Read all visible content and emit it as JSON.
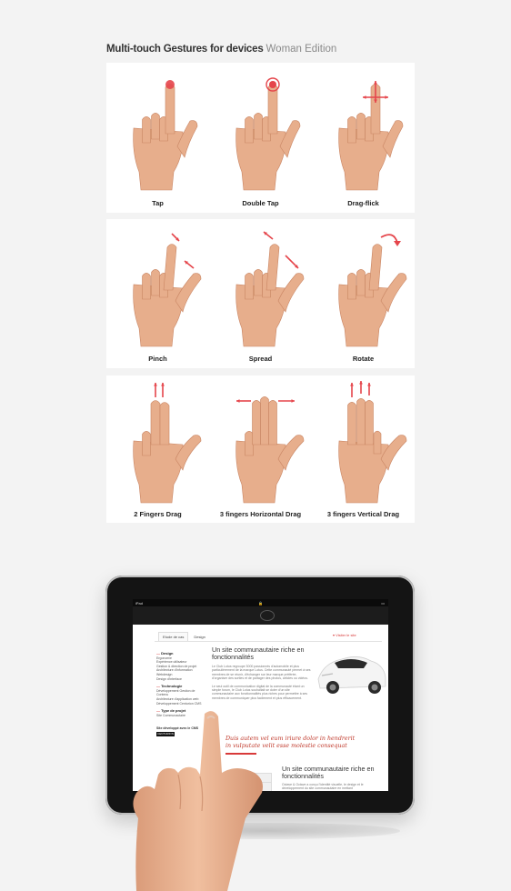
{
  "header": {
    "title": "Multi-touch Gestures for devices",
    "subtitle": "Woman Edition"
  },
  "gestures": [
    {
      "label": "Tap"
    },
    {
      "label": "Double Tap"
    },
    {
      "label": "Drag-flick"
    },
    {
      "label": "Pinch"
    },
    {
      "label": "Spread"
    },
    {
      "label": "Rotate"
    },
    {
      "label": "2 Fingers Drag"
    },
    {
      "label": "3 fingers Horizontal Drag"
    },
    {
      "label": "3 fingers Vertical Drag"
    }
  ],
  "colors": {
    "accent": "#e5454b",
    "skin": "#e7ae8c",
    "skin_shadow": "#c98563"
  },
  "tablet": {
    "status_left": "iPad",
    "status_right": "",
    "tabs": [
      "Etude de cas",
      "Design"
    ],
    "visit_link": "Visiter le site",
    "sidebar": {
      "sections": [
        {
          "heading": "Design",
          "items": [
            "Ergonomie",
            "Expérience utilisateur",
            "Gestion & direction de projet",
            "Architecture d'information",
            "Webdesign",
            "Design d'interface"
          ]
        },
        {
          "heading": "Technologie",
          "items": [
            "Développement Gestion de Contenu",
            "Architecture d'application web",
            "Développement Centurion CMS"
          ]
        },
        {
          "heading": "Type de projet",
          "items": [
            "Site Communautaire"
          ]
        }
      ],
      "cms_note": "Site développé avec le CMS",
      "cms_badge": "CENTURION"
    },
    "main": {
      "title": "Un site communautaire riche en fonctionnalités",
      "para1": "Le Club Lotus regroupe 3000 passionnés d'automobile et plus particulièrement de la marque Lotus. Cette communauté permet à ses membres de se réunir, d'échanger sur leur marque préférée, d'organiser des sorties et de partager des photos, articles ou vidéos.",
      "para2": "Le seul outil de communication digital de la communauté étant un simple forum, le Club Lotus souhaitait se doter d'un site communautaire aux fonctionnalités plus riches pour permettre à ses membres de communiquer plus facilement et plus efficacement.",
      "quote": "Duis autem vel eum iriure dolor in hendrerit in vulputate velit esse molestie consequat",
      "title2": "Un site communautaire riche en fonctionnalités",
      "para3": "Octave & Octave a conçu l'identité visuelle, le design et le développement du site communautaire en mettant",
      "select1": "Lotus",
      "select2": "Lotus Lotus"
    }
  }
}
